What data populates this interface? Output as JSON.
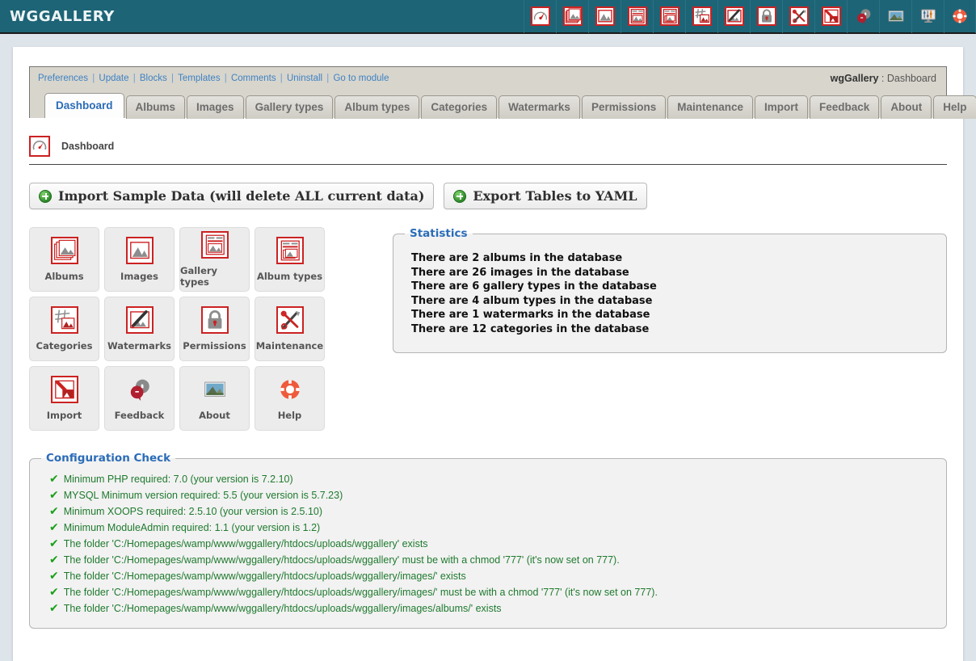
{
  "app": {
    "brand": "WGGALLERY",
    "breadcrumb_module": "wgGallery",
    "breadcrumb_sep": " : ",
    "breadcrumb_page": "Dashboard",
    "accent_teal": "#1d6476",
    "accent_red": "#cc2222",
    "link_blue": "#3e82c4",
    "ok_green": "#1f7a2e"
  },
  "topbar_icons": [
    {
      "name": "dashboard-icon",
      "title": "Dashboard"
    },
    {
      "name": "albums-icon",
      "title": "Albums"
    },
    {
      "name": "images-icon",
      "title": "Images"
    },
    {
      "name": "gallery-types-icon",
      "title": "Gallery types"
    },
    {
      "name": "album-types-icon",
      "title": "Album types"
    },
    {
      "name": "categories-icon",
      "title": "Categories"
    },
    {
      "name": "watermarks-icon",
      "title": "Watermarks"
    },
    {
      "name": "permissions-icon",
      "title": "Permissions"
    },
    {
      "name": "maintenance-icon",
      "title": "Maintenance"
    },
    {
      "name": "import-icon",
      "title": "Import"
    },
    {
      "name": "feedback-icon",
      "title": "Feedback"
    },
    {
      "name": "about-icon",
      "title": "About"
    },
    {
      "name": "system-info-icon",
      "title": "System info"
    },
    {
      "name": "help-icon",
      "title": "Help"
    }
  ],
  "admin_links": [
    "Preferences",
    "Update",
    "Blocks",
    "Templates",
    "Comments",
    "Uninstall",
    "Go to module"
  ],
  "tabs": [
    {
      "label": "Dashboard",
      "active": true
    },
    {
      "label": "Albums",
      "active": false
    },
    {
      "label": "Images",
      "active": false
    },
    {
      "label": "Gallery types",
      "active": false
    },
    {
      "label": "Album types",
      "active": false
    },
    {
      "label": "Categories",
      "active": false
    },
    {
      "label": "Watermarks",
      "active": false
    },
    {
      "label": "Permissions",
      "active": false
    },
    {
      "label": "Maintenance",
      "active": false
    },
    {
      "label": "Import",
      "active": false
    },
    {
      "label": "Feedback",
      "active": false
    },
    {
      "label": "About",
      "active": false
    },
    {
      "label": "Help",
      "active": false
    }
  ],
  "section": {
    "icon": "dashboard-icon",
    "title": "Dashboard"
  },
  "actions": [
    {
      "name": "import-sample-data-button",
      "label": "Import Sample Data (will delete ALL current data)",
      "icon": "add-green-icon"
    },
    {
      "name": "export-tables-yaml-button",
      "label": "Export Tables to YAML",
      "icon": "add-green-icon"
    }
  ],
  "tiles": [
    {
      "label": "Albums",
      "icon": "albums-icon"
    },
    {
      "label": "Images",
      "icon": "images-icon"
    },
    {
      "label": "Gallery types",
      "icon": "gallery-types-icon"
    },
    {
      "label": "Album types",
      "icon": "album-types-icon"
    },
    {
      "label": "Categories",
      "icon": "categories-icon"
    },
    {
      "label": "Watermarks",
      "icon": "watermarks-icon"
    },
    {
      "label": "Permissions",
      "icon": "permissions-icon"
    },
    {
      "label": "Maintenance",
      "icon": "maintenance-icon"
    },
    {
      "label": "Import",
      "icon": "import-icon"
    },
    {
      "label": "Feedback",
      "icon": "feedback-icon"
    },
    {
      "label": "About",
      "icon": "about-icon"
    },
    {
      "label": "Help",
      "icon": "help-icon"
    }
  ],
  "statistics": {
    "legend": "Statistics",
    "lines": [
      "There are 2 albums in the database",
      "There are 26 images in the database",
      "There are 6 gallery types in the database",
      "There are 4 album types in the database",
      "There are 1 watermarks in the database",
      "There are 12 categories in the database"
    ]
  },
  "configuration_check": {
    "legend": "Configuration Check",
    "lines": [
      {
        "status": "ok",
        "mark": "✔",
        "text": "Minimum PHP required: 7.0 (your version is 7.2.10)"
      },
      {
        "status": "ok",
        "mark": "✔",
        "text": "MYSQL Minimum version required: 5.5 (your version is 5.7.23)"
      },
      {
        "status": "ok",
        "mark": "✔",
        "text": "Minimum XOOPS required: 2.5.10 (your version is 2.5.10)"
      },
      {
        "status": "ok",
        "mark": "✔",
        "text": "Minimum ModuleAdmin required: 1.1 (your version is 1.2)"
      },
      {
        "status": "ok",
        "mark": "✔",
        "text": "The folder 'C:/Homepages/wamp/www/wggallery/htdocs/uploads/wggallery' exists"
      },
      {
        "status": "ok",
        "mark": "✔",
        "text": "The folder 'C:/Homepages/wamp/www/wggallery/htdocs/uploads/wggallery' must be with a chmod '777' (it's now set on 777)."
      },
      {
        "status": "ok",
        "mark": "✔",
        "text": "The folder 'C:/Homepages/wamp/www/wggallery/htdocs/uploads/wggallery/images/' exists"
      },
      {
        "status": "ok",
        "mark": "✔",
        "text": "The folder 'C:/Homepages/wamp/www/wggallery/htdocs/uploads/wggallery/images/' must be with a chmod '777' (it's now set on 777)."
      },
      {
        "status": "ok",
        "mark": "✔",
        "text": "The folder 'C:/Homepages/wamp/www/wggallery/htdocs/uploads/wggallery/images/albums/' exists"
      }
    ]
  }
}
